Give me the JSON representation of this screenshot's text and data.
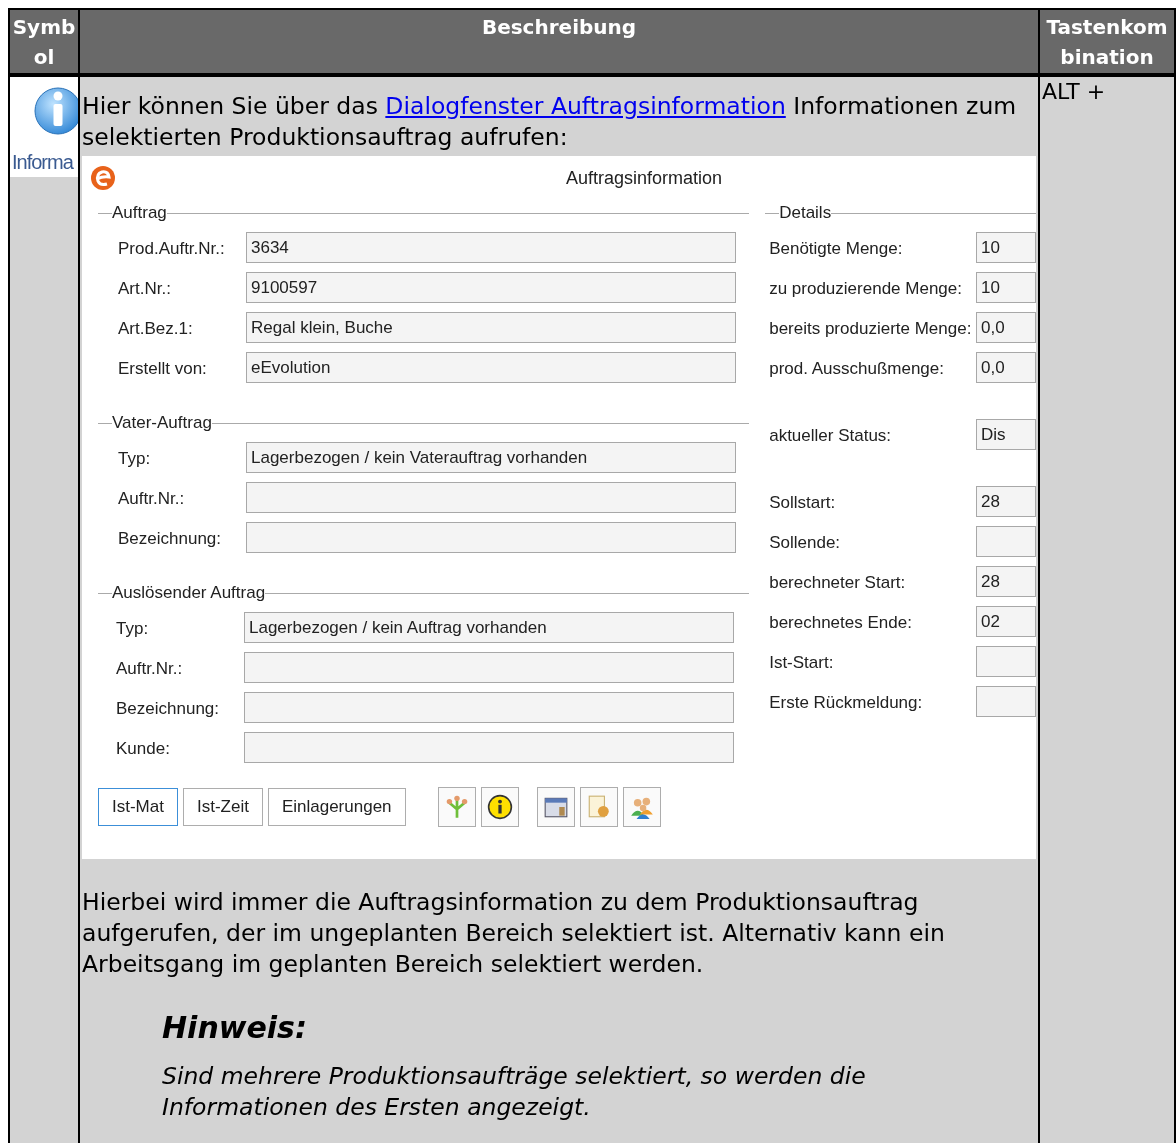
{
  "table": {
    "columns": [
      "Symbol",
      "Beschreibung",
      "Tastenkombination"
    ],
    "row": {
      "symbol_label": "Informa",
      "intro": {
        "before": "Hier können Sie über das ",
        "link": "Dialogfenster Auftragsinformation",
        "after": " Informationen zum selektierten Produktionsauftrag aufrufen:"
      },
      "dialog": {
        "title": "Auftragsinformation",
        "groups": [
          {
            "title": "Auftrag",
            "fields": [
              {
                "label": "Prod.Auftr.Nr.:",
                "value": "3634"
              },
              {
                "label": "Art.Nr.:",
                "value": "9100597"
              },
              {
                "label": "Art.Bez.1:",
                "value": "Regal klein, Buche"
              },
              {
                "label": "Erstellt von:",
                "value": "eEvolution"
              }
            ]
          },
          {
            "title": "Vater-Auftrag",
            "fields": [
              {
                "label": "Typ:",
                "value": "Lagerbezogen / kein Vaterauftrag vorhanden"
              },
              {
                "label": "Auftr.Nr.:"
              },
              {
                "label": "Bezeichnung:"
              }
            ]
          },
          {
            "title": "Auslösender Auftrag",
            "fields": [
              {
                "label": "Typ:",
                "value": "Lagerbezogen / kein Auftrag vorhanden"
              },
              {
                "label": "Auftr.Nr.:"
              },
              {
                "label": "Bezeichnung:"
              },
              {
                "label": "Kunde:"
              }
            ]
          }
        ],
        "details": {
          "title": "Details",
          "sections": [
            [
              {
                "label": "Benötigte Menge:",
                "value": "10"
              },
              {
                "label": "zu produzierende Menge:",
                "value": "10"
              },
              {
                "label": "bereits produzierte Menge:",
                "value": "0,0"
              },
              {
                "label": "prod. Ausschußmenge:",
                "value": "0,0"
              }
            ],
            [
              {
                "label": "aktueller Status:",
                "value": "Dis"
              }
            ],
            [
              {
                "label": "Sollstart:",
                "value": "28"
              },
              {
                "label": "Sollende:"
              },
              {
                "label": "berechneter Start:",
                "value": "28"
              },
              {
                "label": "berechnetes Ende:",
                "value": "02"
              },
              {
                "label": "Ist-Start:"
              },
              {
                "label": "Erste Rückmeldung:"
              }
            ]
          ]
        },
        "buttons": [
          {
            "label": "Ist-Mat",
            "focused": true
          },
          {
            "label": "Ist-Zeit",
            "focused": false
          },
          {
            "label": "Einlagerungen",
            "focused": false
          }
        ]
      },
      "paragraph": "Hierbei wird immer die Auftragsinformation zu dem Produktionsauftrag aufgerufen, der im ungeplanten Bereich selektiert ist. Alternativ kann ein Arbeitsgang im geplanten Bereich selektiert werden.",
      "note": {
        "title": "Hinweis:",
        "text": "Sind mehrere Produktionsaufträge selektiert, so werden die Informationen des Ersten angezeigt."
      },
      "shortcut": "ALT +"
    }
  }
}
